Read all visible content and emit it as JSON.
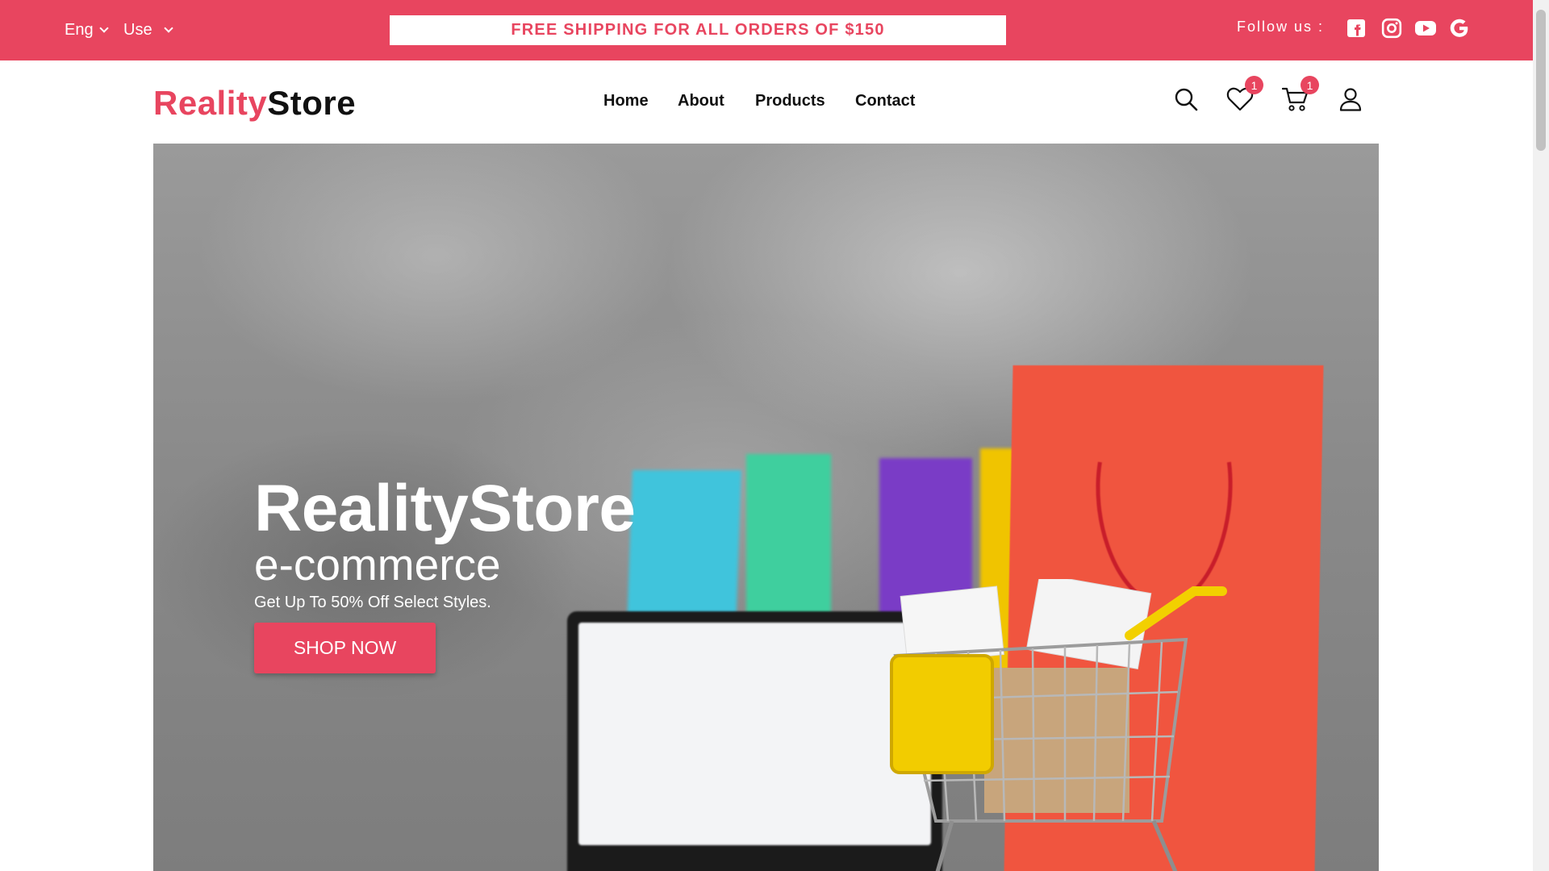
{
  "topbar": {
    "language": "Eng",
    "currency": "Use",
    "promo": "FREE SHIPPING FOR ALL ORDERS OF $150",
    "follow_label": "Follow us :",
    "social_icons": [
      "facebook-icon",
      "instagram-icon",
      "youtube-icon",
      "google-icon"
    ]
  },
  "header": {
    "logo_part1": "Reality",
    "logo_part2": "Store",
    "nav": [
      "Home",
      "About",
      "Products",
      "Contact"
    ],
    "wishlist_count": "1",
    "cart_count": "1",
    "icons": [
      "search-icon",
      "heart-icon",
      "cart-icon",
      "user-icon"
    ]
  },
  "hero": {
    "title": "RealityStore",
    "subtitle": "e-commerce",
    "note": "Get Up To 50% Off Select Styles.",
    "button": "SHOP NOW"
  },
  "colors": {
    "accent": "#e8455f",
    "text": "#111111"
  }
}
